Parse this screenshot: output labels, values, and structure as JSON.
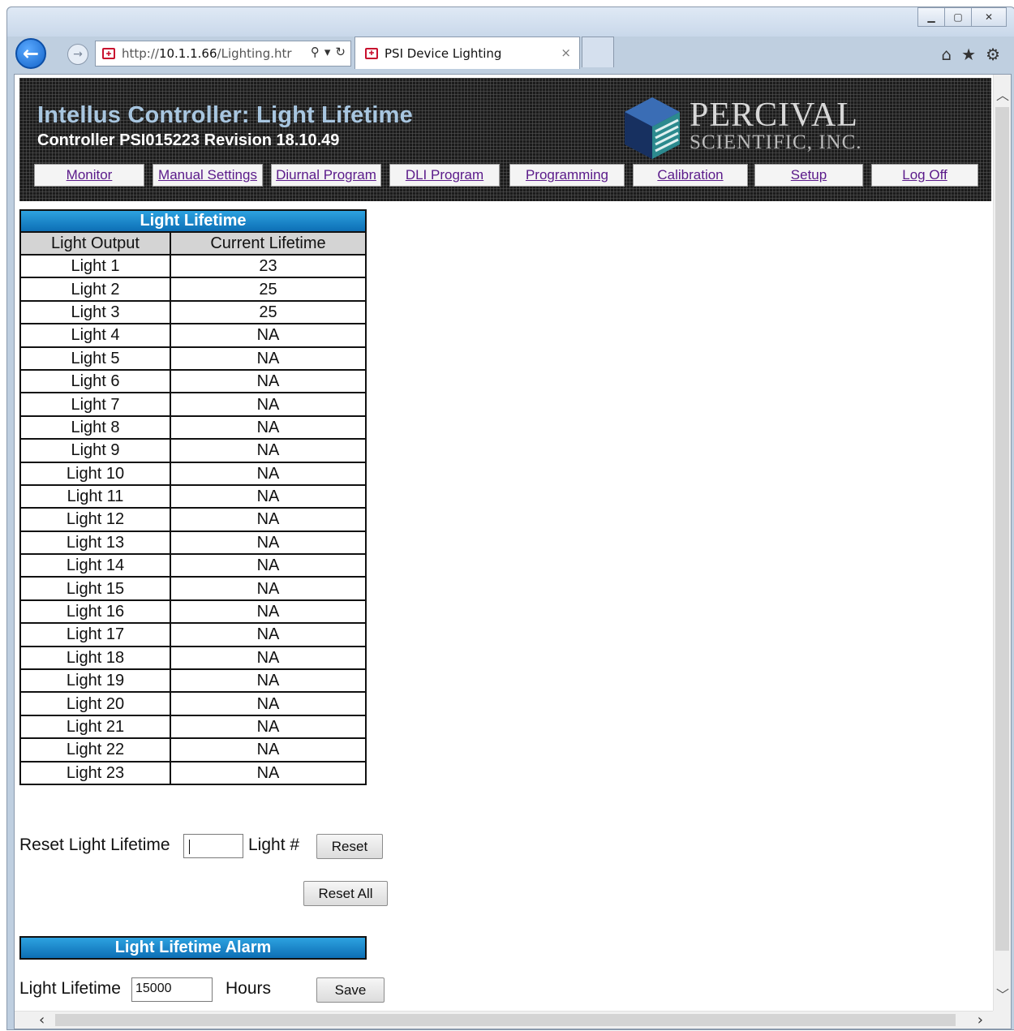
{
  "browser": {
    "url_prefix": "http://",
    "url_host": "10.1.1.66",
    "url_path": "/Lighting.htr",
    "tab_title": "PSI Device Lighting",
    "window_controls": {
      "minimize": "▁",
      "maximize": "▢",
      "close": "✕"
    },
    "tab_close": "×"
  },
  "header": {
    "title": "Intellus Controller: Light Lifetime",
    "subtitle": "Controller PSI015223 Revision 18.10.49",
    "logo_name": "PERCIVAL",
    "logo_sub": "SCIENTIFIC, INC."
  },
  "nav": {
    "monitor": "Monitor",
    "manual_settings": "Manual Settings",
    "diurnal_program": "Diurnal Program",
    "dli_program": "DLI Program",
    "programming": "Programming",
    "calibration": "Calibration",
    "setup": "Setup",
    "log_off": "Log Off"
  },
  "lifetime_table": {
    "title": "Light Lifetime",
    "col_output": "Light Output",
    "col_lifetime": "Current Lifetime",
    "rows": [
      {
        "light": "Light 1",
        "lifetime": "23"
      },
      {
        "light": "Light 2",
        "lifetime": "25"
      },
      {
        "light": "Light 3",
        "lifetime": "25"
      },
      {
        "light": "Light 4",
        "lifetime": "NA"
      },
      {
        "light": "Light 5",
        "lifetime": "NA"
      },
      {
        "light": "Light 6",
        "lifetime": "NA"
      },
      {
        "light": "Light 7",
        "lifetime": "NA"
      },
      {
        "light": "Light 8",
        "lifetime": "NA"
      },
      {
        "light": "Light 9",
        "lifetime": "NA"
      },
      {
        "light": "Light 10",
        "lifetime": "NA"
      },
      {
        "light": "Light 11",
        "lifetime": "NA"
      },
      {
        "light": "Light 12",
        "lifetime": "NA"
      },
      {
        "light": "Light 13",
        "lifetime": "NA"
      },
      {
        "light": "Light 14",
        "lifetime": "NA"
      },
      {
        "light": "Light 15",
        "lifetime": "NA"
      },
      {
        "light": "Light 16",
        "lifetime": "NA"
      },
      {
        "light": "Light 17",
        "lifetime": "NA"
      },
      {
        "light": "Light 18",
        "lifetime": "NA"
      },
      {
        "light": "Light 19",
        "lifetime": "NA"
      },
      {
        "light": "Light 20",
        "lifetime": "NA"
      },
      {
        "light": "Light 21",
        "lifetime": "NA"
      },
      {
        "light": "Light 22",
        "lifetime": "NA"
      },
      {
        "light": "Light 23",
        "lifetime": "NA"
      }
    ]
  },
  "reset": {
    "label": "Reset Light Lifetime",
    "input_value": "",
    "suffix": "Light #",
    "reset_button": "Reset",
    "reset_all_button": "Reset All"
  },
  "alarm": {
    "title": "Light Lifetime Alarm",
    "label": "Light Lifetime",
    "value": "15000",
    "unit": "Hours",
    "save_button": "Save"
  },
  "colors": {
    "header_bar": "#0d6fb5",
    "title_text": "#a8c6e0",
    "link": "#5a1a8a"
  }
}
